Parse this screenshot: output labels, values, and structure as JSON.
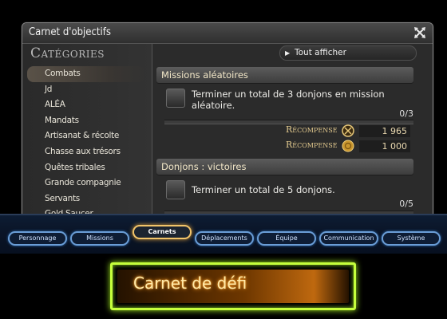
{
  "window": {
    "title": "Carnet d'objectifs",
    "close_icon": "crossed-arrows-icon"
  },
  "sidebar": {
    "heading": "Catégories",
    "items": [
      {
        "label": "Combats",
        "selected": true
      },
      {
        "label": "Jd"
      },
      {
        "label": "ALÉA"
      },
      {
        "label": "Mandats"
      },
      {
        "label": "Artisanat & récolte"
      },
      {
        "label": "Chasse aux trésors"
      },
      {
        "label": "Quêtes tribales"
      },
      {
        "label": "Grande compagnie"
      },
      {
        "label": "Servants"
      },
      {
        "label": "Gold Saucer"
      }
    ]
  },
  "toolbar": {
    "show_all_label": "Tout afficher",
    "show_all_icon": "play-arrow-icon"
  },
  "sections": [
    {
      "title": "Missions aléatoires",
      "objective": "Terminer un total de 3 donjons en mission aléatoire.",
      "count": "0/3",
      "progress": 0,
      "rewards": [
        {
          "label": "Récompense",
          "icon": "seal-icon",
          "value": "1 965"
        },
        {
          "label": "Récompense",
          "icon": "gil-icon",
          "value": "1 000"
        }
      ]
    },
    {
      "title": "Donjons : victoires",
      "objective": "Terminer un total de 5 donjons.",
      "count": "0/5",
      "progress": 0
    }
  ],
  "nav": {
    "buttons": [
      {
        "label": "Personnage"
      },
      {
        "label": "Missions"
      },
      {
        "label": "Carnets",
        "active": true
      },
      {
        "label": "Déplacements"
      },
      {
        "label": "Équipe"
      },
      {
        "label": "Communication"
      },
      {
        "label": "Système"
      }
    ]
  },
  "highlight": {
    "label": "Carnet de défi",
    "border_color": "#c5ff3c"
  },
  "colors": {
    "accent_gold": "#e2c98e",
    "nav_blue": "#6a9dd6",
    "active_gold": "#f2c46a"
  }
}
